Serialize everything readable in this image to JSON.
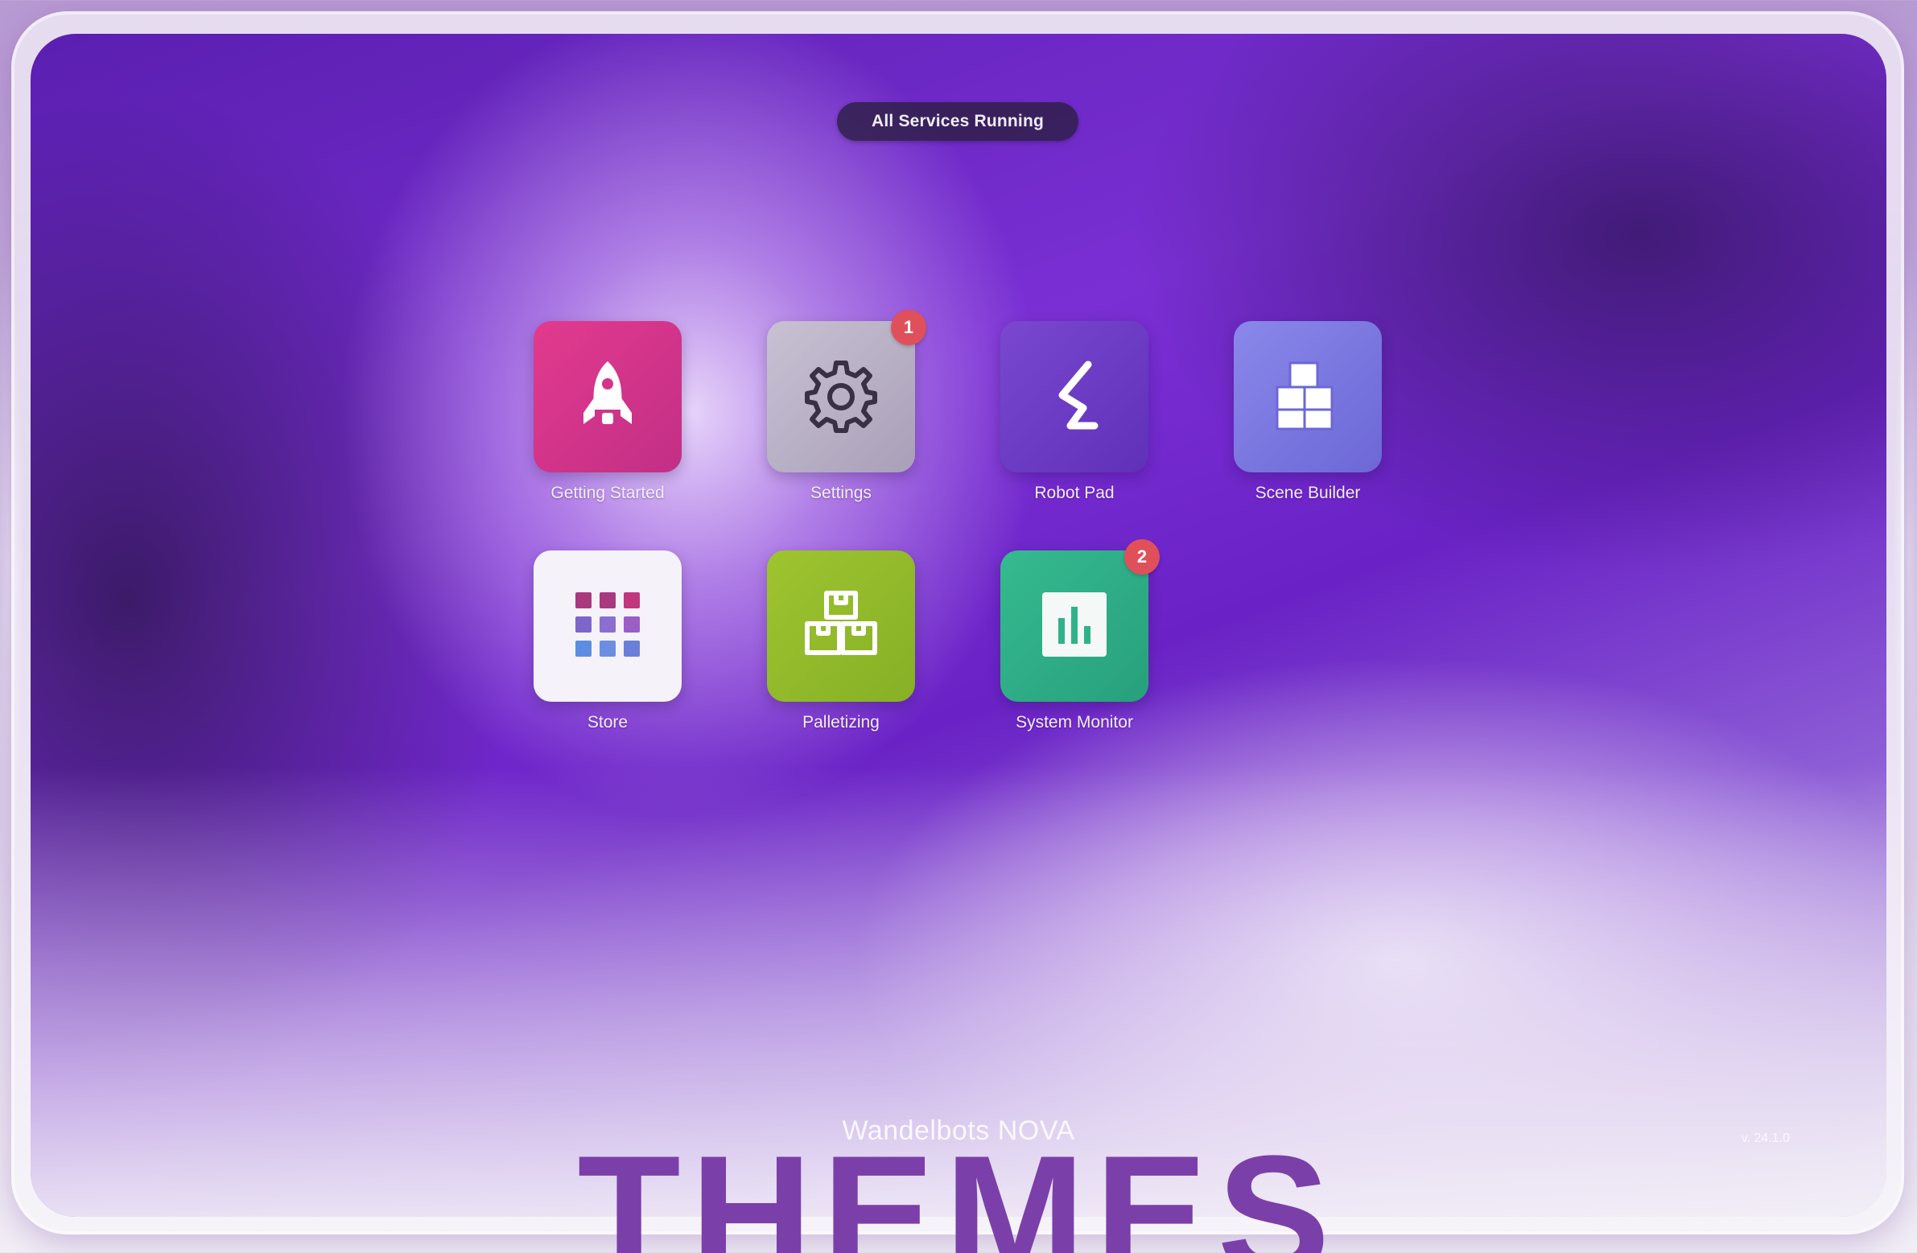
{
  "status": {
    "label": "All Services Running"
  },
  "apps": [
    {
      "label": "Getting Started",
      "icon": "rocket-icon",
      "color": "#d6338a",
      "badge": null
    },
    {
      "label": "Settings",
      "icon": "gear-icon",
      "color": "#b8b0c4",
      "badge": "1"
    },
    {
      "label": "Robot Pad",
      "icon": "robot-arm-icon",
      "color": "#6e3dc4",
      "badge": null
    },
    {
      "label": "Scene Builder",
      "icon": "cubes-icon",
      "color": "#7b78e0",
      "badge": null
    },
    {
      "label": "Store",
      "icon": "grid-icon",
      "color": "#f6f2fa",
      "badge": null
    },
    {
      "label": "Palletizing",
      "icon": "boxes-icon",
      "color": "#93bd2a",
      "badge": null
    },
    {
      "label": "System Monitor",
      "icon": "chart-icon",
      "color": "#2fb28a",
      "badge": "2"
    }
  ],
  "footer": {
    "brand": "Wandelbots NOVA",
    "version": "v. 24.1.0"
  },
  "hero": {
    "title": "THEMES"
  },
  "colors": {
    "badge": "#e0505a",
    "title": "#7b3fa9"
  }
}
